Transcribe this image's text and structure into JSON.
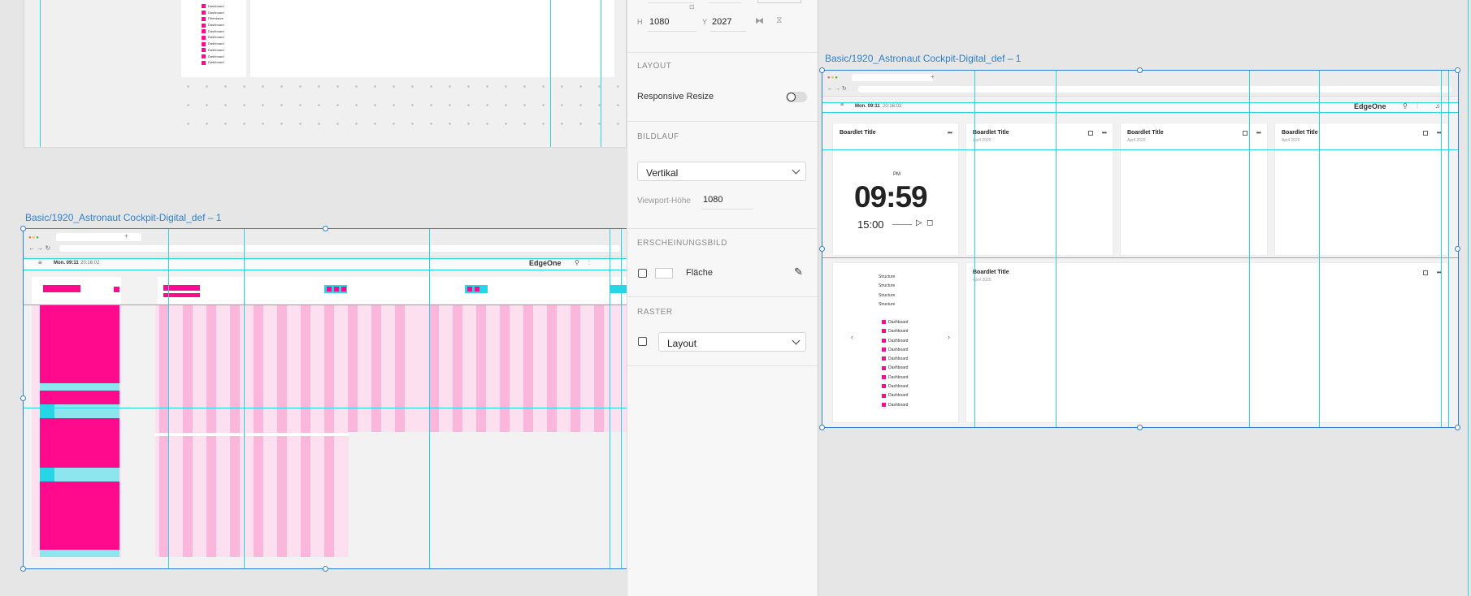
{
  "canvas": {
    "top_artboard": {
      "tree_items": [
        "Dashboard",
        "Dashboard",
        "Filterdarve",
        "Dashboard",
        "Dashboard",
        "Dashboard",
        "Dashboard",
        "Dashboard",
        "Dashboard",
        "Dashboard"
      ]
    },
    "left_artboard": {
      "label": "Basic/1920_Astronaut Cockpit-Digital_def – 1",
      "time": "Mon. 09:11",
      "time_sub": "20:16:02",
      "brand": "EdgeOne"
    },
    "right_artboard": {
      "label": "Basic/1920_Astronaut Cockpit-Digital_def – 1",
      "time": "Mon. 09:11",
      "time_sub": "20:16:02",
      "brand": "EdgeOne",
      "boardlets": [
        {
          "title": "Boardlet Title",
          "subtitle": ""
        },
        {
          "title": "Boardlet Title",
          "subtitle": "April 2020"
        },
        {
          "title": "Boardlet Title",
          "subtitle": "April 2020"
        },
        {
          "title": "Boardlet Title",
          "subtitle": "April 2020"
        },
        {
          "title": "Boardlet Title",
          "subtitle": "April 2020"
        }
      ],
      "clock": {
        "ampm": "PM",
        "big": "09:59",
        "small": "15:00"
      },
      "structure": [
        "Structure",
        "Structure",
        "Structure",
        "Structure"
      ],
      "dashboard_items": [
        "Dashboard",
        "Dashboard",
        "Dashboard",
        "Dashboard",
        "Dashboard",
        "Dashboard",
        "Dashboard",
        "Dashboard",
        "Dashboard",
        "Dashboard"
      ]
    }
  },
  "inspector": {
    "h_label": "H",
    "h_value": "1080",
    "y_label": "Y",
    "y_value": "2027",
    "layout_section": "LAYOUT",
    "responsive_label": "Responsive Resize",
    "responsive_on": false,
    "scroll_section": "BILDLAUF",
    "scroll_value": "Vertikal",
    "viewport_label": "Viewport-Höhe",
    "viewport_value": "1080",
    "appearance_section": "ERSCHEINUNGSBILD",
    "fill_label": "Fläche",
    "grid_section": "RASTER",
    "grid_value": "Layout"
  },
  "colors": {
    "accent": "#27d6e6",
    "pink": "#ff0a8c",
    "selection": "#2f80d0"
  }
}
